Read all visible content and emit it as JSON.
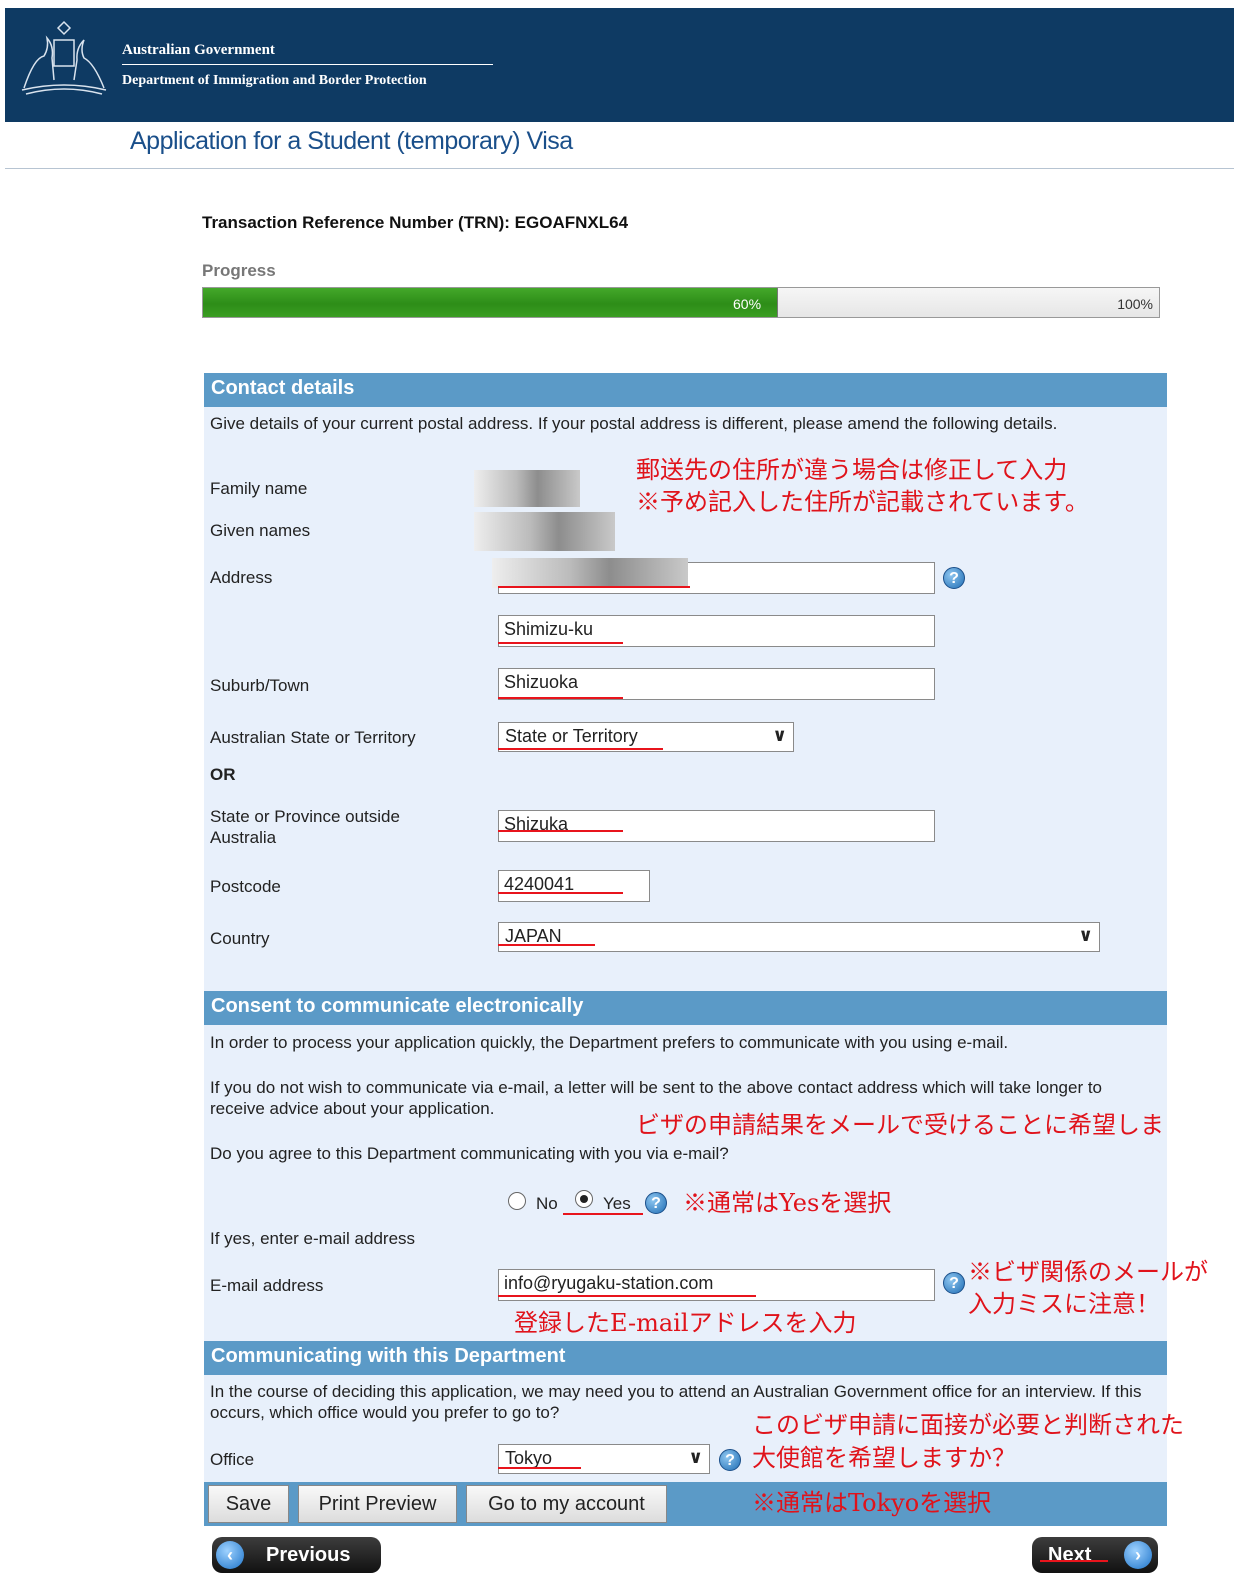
{
  "header": {
    "gov_name": "Australian Government",
    "dept_name": "Department of Immigration and Border Protection",
    "bg_color": "#0e3a63"
  },
  "page_title": "Application for a Student (temporary) Visa",
  "trn": "Transaction Reference Number (TRN): EGOAFNXL64",
  "progress": {
    "label": "Progress",
    "value": 0.6,
    "current_text": "60%",
    "max_text": "100%"
  },
  "contact": {
    "heading": "Contact details",
    "intro": "Give details of your current postal address. If your postal address is different, please amend the following details.",
    "family_name_label": "Family name",
    "given_names_label": "Given names",
    "address_label": "Address",
    "address_line2": "Shimizu-ku",
    "suburb_label": "Suburb/Town",
    "suburb_value": "Shizuoka",
    "state_label": "Australian State or Territory",
    "state_value": "State or Territory",
    "or_label": "OR",
    "province_label": "State or Province outside Australia",
    "province_value": "Shizuka",
    "postcode_label": "Postcode",
    "postcode_value": "4240041",
    "country_label": "Country",
    "country_value": "JAPAN"
  },
  "consent": {
    "heading": "Consent to communicate electronically",
    "para1": "In order to process your application quickly, the Department prefers to communicate with you using e-mail.",
    "para2": "If you do not wish to communicate via e-mail, a letter will be sent to the above contact address which will take longer to receive advice about your application.",
    "question": "Do you agree to this Department communicating with you via e-mail?",
    "no_label": "No",
    "yes_label": "Yes",
    "selected": "Yes",
    "email_prompt": "If yes, enter e-mail address",
    "email_label": "E-mail address",
    "email_value": "info@ryugaku-station.com"
  },
  "department": {
    "heading": "Communicating with this Department",
    "para": "In the course of deciding this application, we may need you to attend an Australian Government office for an interview. If this occurs, which office would you prefer to go to?",
    "office_label": "Office",
    "office_value": "Tokyo"
  },
  "buttons": {
    "save": "Save",
    "print_preview": "Print Preview",
    "account": "Go to my account"
  },
  "nav": {
    "previous": "Previous",
    "next": "Next"
  },
  "annotations": {
    "address_note_1": "郵送先の住所が違う場合は修正して入力",
    "address_note_2": "※予め記入した住所が記載されています。",
    "email_result": "ビザの申請結果をメールで受けることに希望しま",
    "yes_note": "※通常はYesを選択",
    "email_warn_1": "※ビザ関係のメールが",
    "email_warn_2": "入力ミスに注意！",
    "email_input_note": "登録したE-mailアドレスを入力",
    "interview_1": "このビザ申請に面接が必要と判断された",
    "interview_2": "大使館を希望しますか？",
    "tokyo_note": "※通常はTokyoを選択"
  },
  "colors": {
    "section_bar": "#5b9ac7",
    "panel_bg": "#e8f0fb",
    "annotation_red": "#e0131b",
    "progress_green": "#2d8d18"
  }
}
